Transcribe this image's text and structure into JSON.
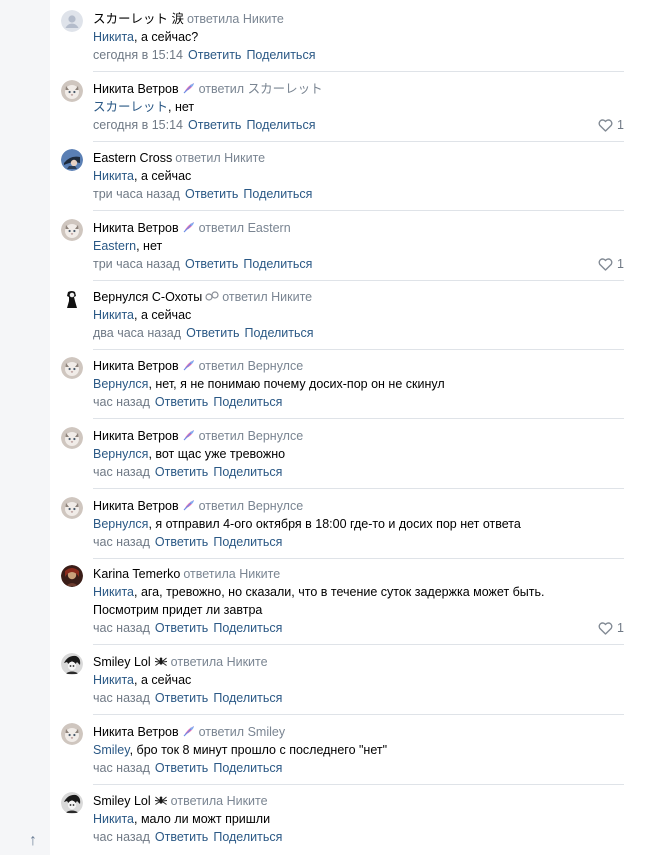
{
  "actions": {
    "reply": "Ответить",
    "share": "Поделиться"
  },
  "comments": [
    {
      "author": "スカーレット 涙",
      "action": "ответила",
      "target": "Никите",
      "mention": "Никита",
      "text": ", а сейчас?",
      "time": "сегодня в 15:14",
      "likes": "",
      "avatar": "avatar-grey-default",
      "badge": ""
    },
    {
      "author": "Никита Ветров",
      "action": "ответил",
      "target": "スカーレット",
      "mention": "スカーレット",
      "text": ", нет",
      "time": "сегодня в 15:14",
      "likes": "1",
      "avatar": "avatar-cat",
      "badge": "feather-icon"
    },
    {
      "author": "Eastern Cross",
      "action": "ответил",
      "target": "Никите",
      "mention": "Никита",
      "text": ", а сейчас",
      "time": "три часа назад",
      "likes": "",
      "avatar": "avatar-anime-blue",
      "badge": ""
    },
    {
      "author": "Никита Ветров",
      "action": "ответил",
      "target": "Eastern",
      "mention": "Eastern",
      "text": ", нет",
      "time": "три часа назад",
      "likes": "1",
      "avatar": "avatar-cat",
      "badge": "feather-icon"
    },
    {
      "author": "Вернулся С-Охоты",
      "action": "ответил",
      "target": "Никите",
      "mention": "Никита",
      "text": ", а сейчас",
      "time": "два часа назад",
      "likes": "",
      "avatar": "avatar-bw-figure",
      "badge": "handcuffs-icon"
    },
    {
      "author": "Никита Ветров",
      "action": "ответил",
      "target": "Вернулсе",
      "mention": "Вернулся",
      "text": ", нет, я не понимаю почему досих-пор он не скинул",
      "time": "час назад",
      "likes": "",
      "avatar": "avatar-cat",
      "badge": "feather-icon"
    },
    {
      "author": "Никита Ветров",
      "action": "ответил",
      "target": "Вернулсе",
      "mention": "Вернулся",
      "text": ", вот щас уже тревожно",
      "time": "час назад",
      "likes": "",
      "avatar": "avatar-cat",
      "badge": "feather-icon"
    },
    {
      "author": "Никита Ветров",
      "action": "ответил",
      "target": "Вернулсе",
      "mention": "Вернулся",
      "text": ", я отправил 4-ого октября в 18:00 где-то и досих пор нет ответа",
      "time": "час назад",
      "likes": "",
      "avatar": "avatar-cat",
      "badge": "feather-icon"
    },
    {
      "author": "Karina Temerko",
      "action": "ответила",
      "target": "Никите",
      "mention": "Никита",
      "text": ", ага, тревожно, но сказали, что в течение суток задержка может быть.",
      "text2": "Посмотрим придет ли завтра",
      "time": "час назад",
      "likes": "1",
      "avatar": "avatar-dark-red",
      "badge": ""
    },
    {
      "author": "Smiley Lol",
      "action": "ответила",
      "target": "Никите",
      "mention": "Никита",
      "text": ", а сейчас",
      "time": "час назад",
      "likes": "",
      "avatar": "avatar-anime-bw",
      "badge": "spider-icon"
    },
    {
      "author": "Никита Ветров",
      "action": "ответил",
      "target": "Smiley",
      "mention": "Smiley",
      "text": ", бро ток 8 минут прошло с последнего \"нет\"",
      "time": "час назад",
      "likes": "",
      "avatar": "avatar-cat",
      "badge": "feather-icon"
    },
    {
      "author": "Smiley Lol",
      "action": "ответила",
      "target": "Никите",
      "mention": "Никита",
      "text": ", мало ли можт пришли",
      "time": "час назад",
      "likes": "",
      "avatar": "avatar-anime-bw",
      "badge": "spider-icon"
    }
  ],
  "colors": {
    "link": "#2a5885",
    "muted": "#7a8592",
    "divider": "#dfe3e8"
  }
}
